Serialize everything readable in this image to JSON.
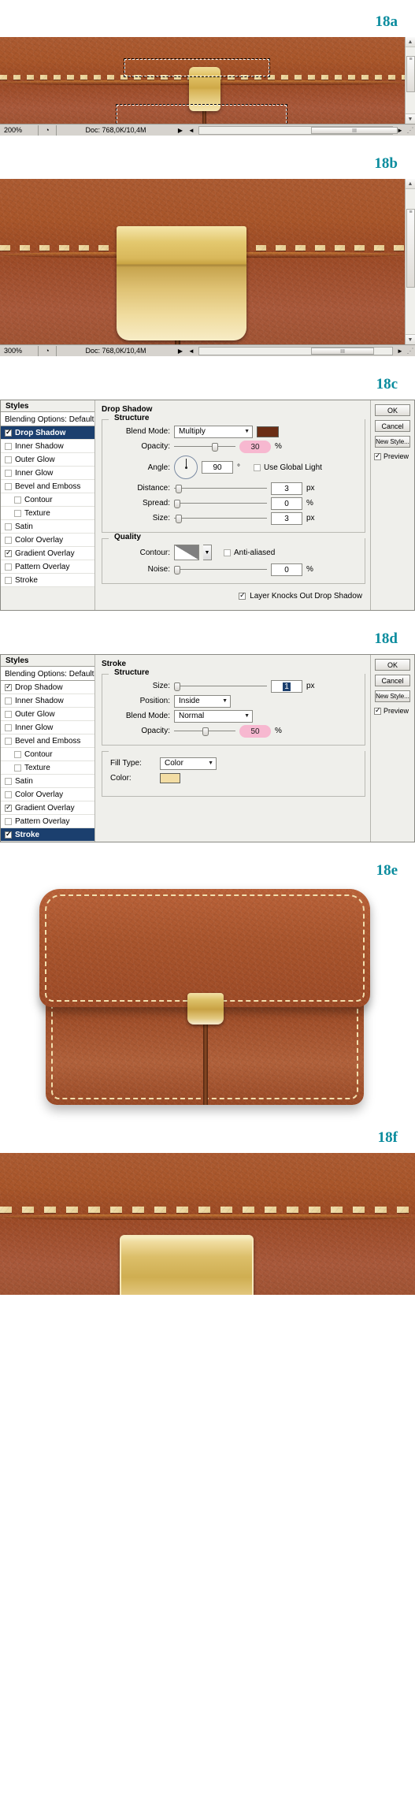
{
  "figures": {
    "a": "18a",
    "b": "18b",
    "c": "18c",
    "d": "18d",
    "e": "18e",
    "f": "18f"
  },
  "statusbar_a": {
    "zoom": "200%",
    "doc": "Doc: 768,0K/10,4M",
    "play_icon": "▶",
    "left_arrow": "◄",
    "right_arrow": "►",
    "thumb_grip": "III",
    "clock_icon": "◔",
    "resize_grip": "⋰"
  },
  "statusbar_b": {
    "zoom": "300%",
    "doc": "Doc: 768,0K/10,4M",
    "play_icon": "▶",
    "left_arrow": "◄",
    "right_arrow": "►",
    "thumb_grip": "III",
    "clock_icon": "◔",
    "resize_grip": "⋰"
  },
  "styles_panel": {
    "header": "Styles",
    "blending_options": "Blending Options: Default",
    "items": [
      {
        "label": "Drop Shadow",
        "checked": true,
        "indent": false
      },
      {
        "label": "Inner Shadow",
        "checked": false,
        "indent": false
      },
      {
        "label": "Outer Glow",
        "checked": false,
        "indent": false
      },
      {
        "label": "Inner Glow",
        "checked": false,
        "indent": false
      },
      {
        "label": "Bevel and Emboss",
        "checked": false,
        "indent": false
      },
      {
        "label": "Contour",
        "checked": false,
        "indent": true
      },
      {
        "label": "Texture",
        "checked": false,
        "indent": true
      },
      {
        "label": "Satin",
        "checked": false,
        "indent": false
      },
      {
        "label": "Color Overlay",
        "checked": false,
        "indent": false
      },
      {
        "label": "Gradient Overlay",
        "checked": true,
        "indent": false
      },
      {
        "label": "Pattern Overlay",
        "checked": false,
        "indent": false
      },
      {
        "label": "Stroke",
        "checked": false,
        "indent": false
      }
    ]
  },
  "drop_shadow": {
    "title": "Drop Shadow",
    "structure_title": "Structure",
    "blend_mode_label": "Blend Mode:",
    "blend_mode_value": "Multiply",
    "shadow_color": "#6b2d15",
    "opacity_label": "Opacity:",
    "opacity_value": "30",
    "opacity_unit": "%",
    "angle_label": "Angle:",
    "angle_value": "90",
    "angle_unit": "°",
    "use_global_light": "Use Global Light",
    "distance_label": "Distance:",
    "distance_value": "3",
    "distance_unit": "px",
    "spread_label": "Spread:",
    "spread_value": "0",
    "spread_unit": "%",
    "size_label": "Size:",
    "size_value": "3",
    "size_unit": "px",
    "quality_title": "Quality",
    "contour_label": "Contour:",
    "anti_aliased": "Anti-aliased",
    "noise_label": "Noise:",
    "noise_value": "0",
    "noise_unit": "%",
    "knocks_out": "Layer Knocks Out Drop Shadow",
    "selected_style": "Drop Shadow"
  },
  "stroke": {
    "title": "Stroke",
    "structure_title": "Structure",
    "size_label": "Size:",
    "size_value": "1",
    "size_unit": "px",
    "position_label": "Position:",
    "position_value": "Inside",
    "blend_mode_label": "Blend Mode:",
    "blend_mode_value": "Normal",
    "opacity_label": "Opacity:",
    "opacity_value": "50",
    "opacity_unit": "%",
    "fill_type_label": "Fill Type:",
    "fill_type_value": "Color",
    "color_label": "Color:",
    "color_value": "#f3dda4",
    "selected_style": "Stroke"
  },
  "side_buttons": {
    "ok": "OK",
    "cancel": "Cancel",
    "new_style": "New Style...",
    "preview": "Preview"
  },
  "colors": {
    "caption": "#0b8c9e",
    "selection_blue": "#1b3f6e",
    "pink_field": "#f7b8d0",
    "leather_top": "#ab5a31",
    "leather_bottom": "#9c4a26",
    "brass_light": "#f3e2a8",
    "brass_dark": "#c9a244",
    "stitch": "#f0dca6",
    "dialog_bg": "#efefeb"
  }
}
